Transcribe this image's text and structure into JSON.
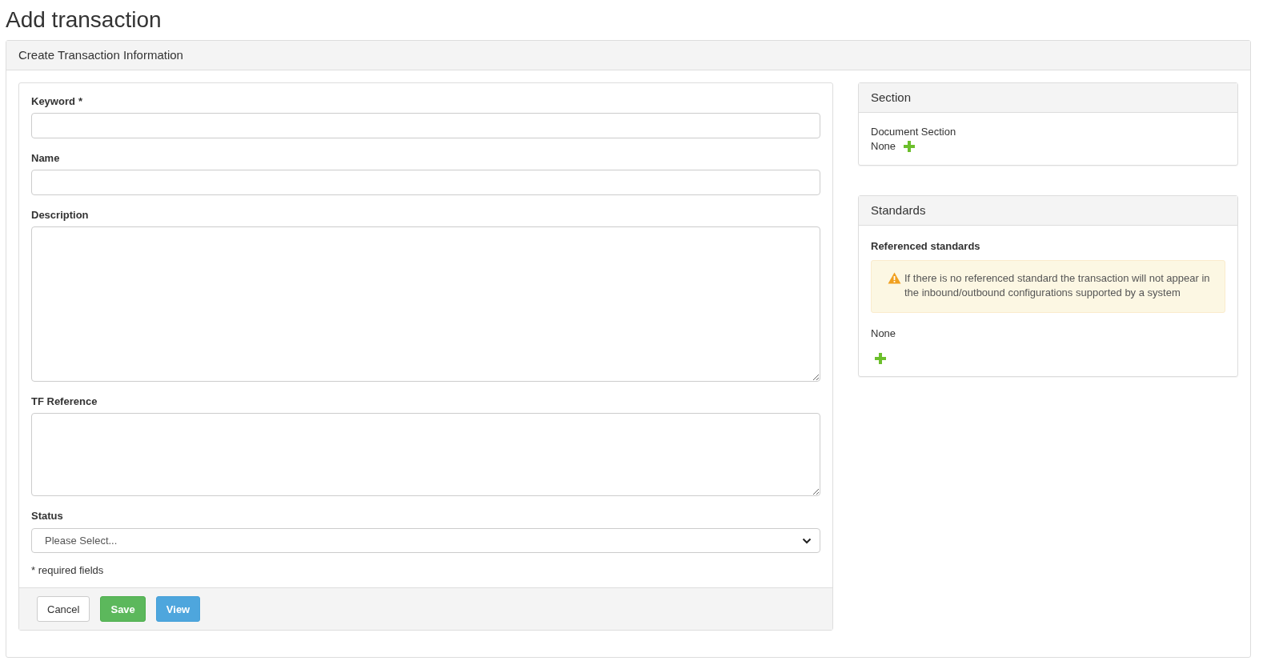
{
  "page_title": "Add transaction",
  "panel_title": "Create Transaction Information",
  "form": {
    "fields": [
      {
        "kind": "input",
        "label": "Keyword",
        "required_mark": "*"
      },
      {
        "kind": "input",
        "label": "Name"
      },
      {
        "kind": "textarea",
        "label": "Description"
      },
      {
        "kind": "textarea",
        "label": "TF Reference"
      },
      {
        "kind": "select",
        "label": "Status",
        "placeholder": "Please Select..."
      }
    ],
    "note": "* required fields",
    "buttons": [
      {
        "kind": "default",
        "label": "Cancel"
      },
      {
        "kind": "success",
        "label": "Save"
      },
      {
        "kind": "info",
        "label": "View"
      }
    ]
  },
  "section_panel": {
    "title": "Section",
    "label": "Document Section",
    "value": "None"
  },
  "standards_panel": {
    "title": "Standards",
    "heading": "Referenced standards",
    "warning": "If there is no referenced standard the transaction will not appear in the inbound/outbound configurations supported by a system",
    "value": "None"
  }
}
